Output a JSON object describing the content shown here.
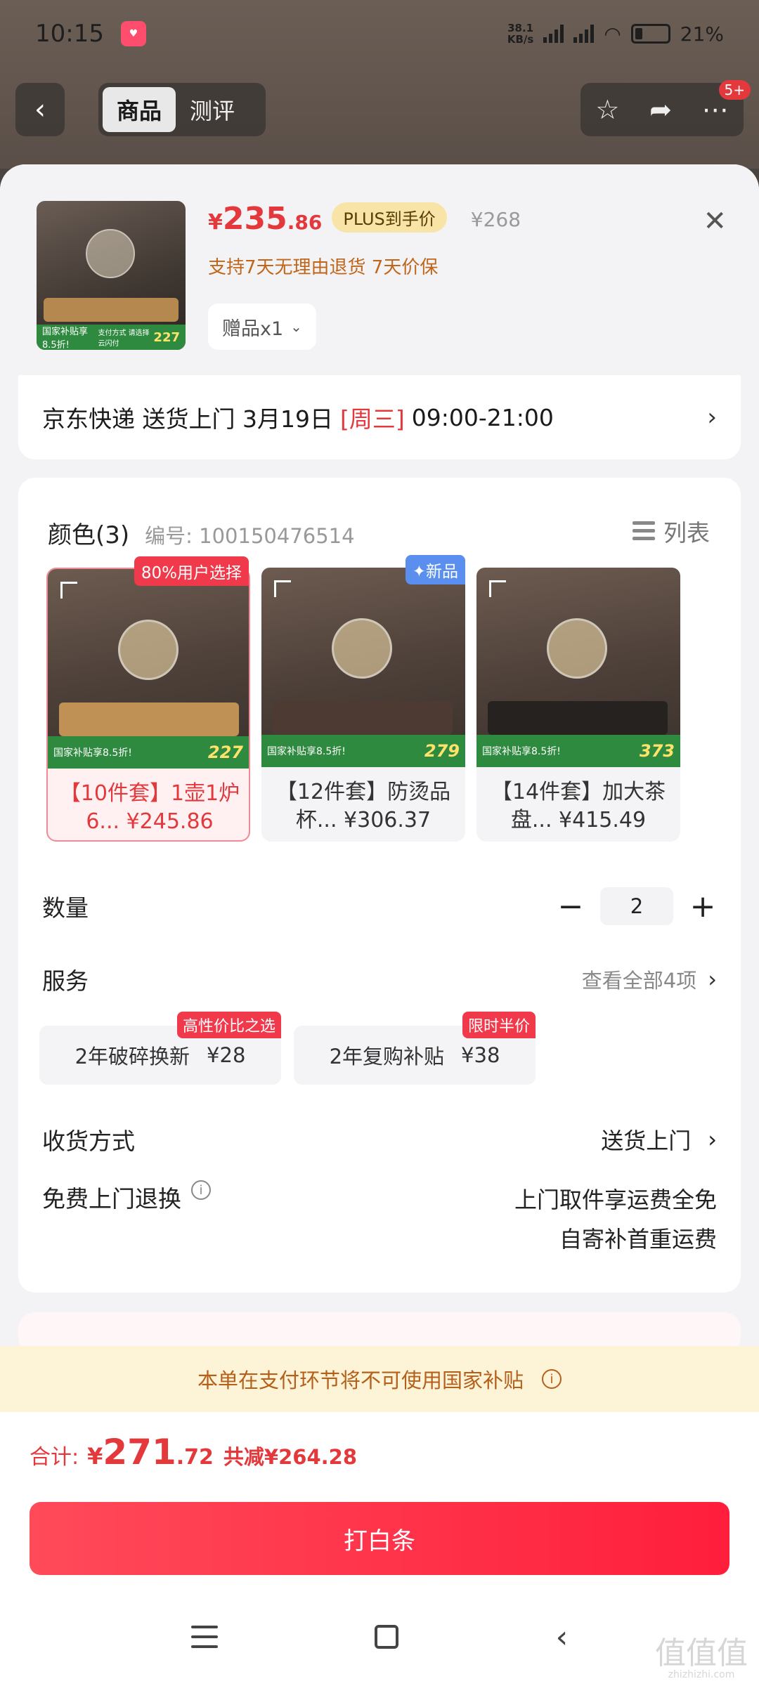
{
  "status_bar": {
    "time": "10:15",
    "speed_value": "38.1",
    "speed_unit": "KB/s",
    "battery": "21%"
  },
  "top_nav": {
    "tabs": [
      "商品",
      "测评"
    ],
    "badge": "5+"
  },
  "product": {
    "thumb_strip_left": "国家补贴享8.5折!",
    "thumb_strip_mid": "支付方式 请选择云闪付",
    "thumb_strip_num": "227",
    "price_yen": "¥",
    "price_int": "235",
    "price_dec": ".86",
    "plus_label": "PLUS到手价",
    "original_price": "¥268",
    "return_policy": "支持7天无理由退货  7天价保",
    "gift": "赠品x1"
  },
  "delivery": {
    "prefix": "京东快递 送货上门 3月19日",
    "weekday": "[周三]",
    "time_window": "09:00-21:00"
  },
  "color_section": {
    "title": "颜色(3)",
    "sku_label": "编号: 100150476514",
    "list_toggle": "列表",
    "variants": [
      {
        "name": "【10件套】1壶1炉6... ¥245.86",
        "tag": "80%用户选择",
        "strip_num": "227",
        "selected": true
      },
      {
        "name": "【12件套】防烫品杯... ¥306.37",
        "tag": "✦新品",
        "strip_num": "279",
        "selected": false
      },
      {
        "name": "【14件套】加大茶盘... ¥415.49",
        "tag": "",
        "strip_num": "373",
        "selected": false
      }
    ],
    "strip_left": "国家补贴享8.5折!",
    "strip_mid": "支付方式 请选择云闪付"
  },
  "quantity": {
    "label": "数量",
    "minus": "−",
    "value": "2",
    "plus": "+"
  },
  "service": {
    "label": "服务",
    "view_all": "查看全部4项",
    "items": [
      {
        "name": "2年破碎换新",
        "price": "¥28",
        "tag": "高性价比之选"
      },
      {
        "name": "2年复购补贴",
        "price": "¥38",
        "tag": "限时半价"
      }
    ]
  },
  "receive": {
    "label": "收货方式",
    "value": "送货上门"
  },
  "free_return": {
    "label": "免费上门退换",
    "line1": "上门取件享运费全免",
    "line2": "自寄补首重运费"
  },
  "notice": {
    "text": "本单在支付环节将不可使用国家补贴"
  },
  "footer": {
    "total_label": "合计:",
    "total_yen": "¥",
    "total_int": "271",
    "total_dec": ".72",
    "discount": "共减¥264.28",
    "pay_button": "打白条"
  },
  "watermark": {
    "big": "值值值",
    "small": "zhizhizhi.com"
  },
  "icons": [
    "back-icon",
    "star-icon",
    "share-icon",
    "more-icon",
    "close-icon",
    "chevron-right-icon",
    "list-icon",
    "expand-icon",
    "info-icon",
    "menu-icon",
    "home-icon",
    "nav-back-icon"
  ],
  "colors": {
    "accent": "#e4393c",
    "notice_bg": "#fdf4d8",
    "pay_button": "#ff2a45"
  }
}
